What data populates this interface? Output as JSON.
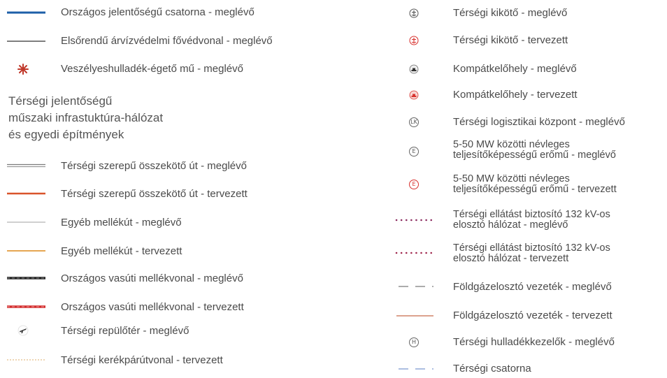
{
  "colors": {
    "blue_canal": "#1d5fa8",
    "black": "#333333",
    "red_star": "#c0392b",
    "road_existing": "#8a8a8a",
    "road_planned": "#d9542b",
    "minor_road_existing": "#b5b5b5",
    "minor_road_planned": "#e39a3a",
    "rail_existing": "#222222",
    "rail_planned": "#d22a2a",
    "bike_planned": "#e8c79a",
    "power_line": "#8b2a5e",
    "gas_existing": "#7a7a7a",
    "gas_planned": "#c86b4a",
    "regional_canal": "#7b96cf"
  },
  "heading": "Térségi jelentőségű\nműszaki infrastuktúra-hálózat\nés egyedi építmények",
  "left_items": [
    {
      "label": "Országos jelentőségű csatorna - meglévő",
      "symbol": "blue-line"
    },
    {
      "label": "Elsőrendű árvízvédelmi fővédvonal - meglévő",
      "symbol": "thin-black-line"
    },
    {
      "label": "Veszélyeshulladék-égető mű - meglévő",
      "symbol": "red-star-icon"
    }
  ],
  "left_items2": [
    {
      "label": "Térségi szerepű összekötő út - meglévő",
      "symbol": "gray-double-line"
    },
    {
      "label": "Térségi szerepű összekötő út - tervezett",
      "symbol": "orange-red-line"
    },
    {
      "label": "Egyéb mellékút - meglévő",
      "symbol": "light-gray-line"
    },
    {
      "label": "Egyéb mellékút - tervezett",
      "symbol": "orange-line"
    },
    {
      "label": "Országos vasúti mellékvonal - meglévő",
      "symbol": "black-rail-line"
    },
    {
      "label": "Országos vasúti mellékvonal - tervezett",
      "symbol": "red-rail-line"
    },
    {
      "label": "Térségi repülőtér - meglévő",
      "symbol": "airplane-icon"
    },
    {
      "label": "Térségi kerékpárútvonal - tervezett",
      "symbol": "bike-dotted-line"
    }
  ],
  "right_items": [
    {
      "label": "Térségi kikötő - meglévő",
      "symbol": "anchor-gray-icon"
    },
    {
      "label": "Térségi kikötő - tervezett",
      "symbol": "anchor-red-icon"
    },
    {
      "label": "Kompátkelőhely - meglévő",
      "symbol": "ferry-gray-icon"
    },
    {
      "label": "Kompátkelőhely - tervezett",
      "symbol": "ferry-red-icon"
    },
    {
      "label": "Térségi logisztikai központ - meglévő",
      "symbol": "logistics-icon",
      "glyph": "LK"
    },
    {
      "label": "5-50 MW közötti névleges\nteljesítőképességű erőmű - meglévő",
      "symbol": "power-plant-gray-icon",
      "glyph": "E"
    },
    {
      "label": "5-50 MW közötti névleges\nteljesítőképességű erőmű - tervezett",
      "symbol": "power-plant-red-icon",
      "glyph": "E"
    },
    {
      "label": "Térségi ellátást biztosító 132 kV-os\nelosztó hálózat - meglévő",
      "symbol": "power-line-dotted"
    },
    {
      "label": "Térségi ellátást biztosító 132 kV-os\nelosztó hálózat - tervezett",
      "symbol": "power-line-dotted-red"
    },
    {
      "label": "Földgázelosztó vezeték - meglévő",
      "symbol": "gas-dashed-line"
    },
    {
      "label": "Földgázelosztó vezeték - tervezett",
      "symbol": "gas-solid-line"
    },
    {
      "label": "Térségi hulladékkezelők - meglévő",
      "symbol": "waste-icon",
      "glyph": "H"
    },
    {
      "label": "Térségi csatorna",
      "symbol": "canal-dashed-line"
    }
  ]
}
